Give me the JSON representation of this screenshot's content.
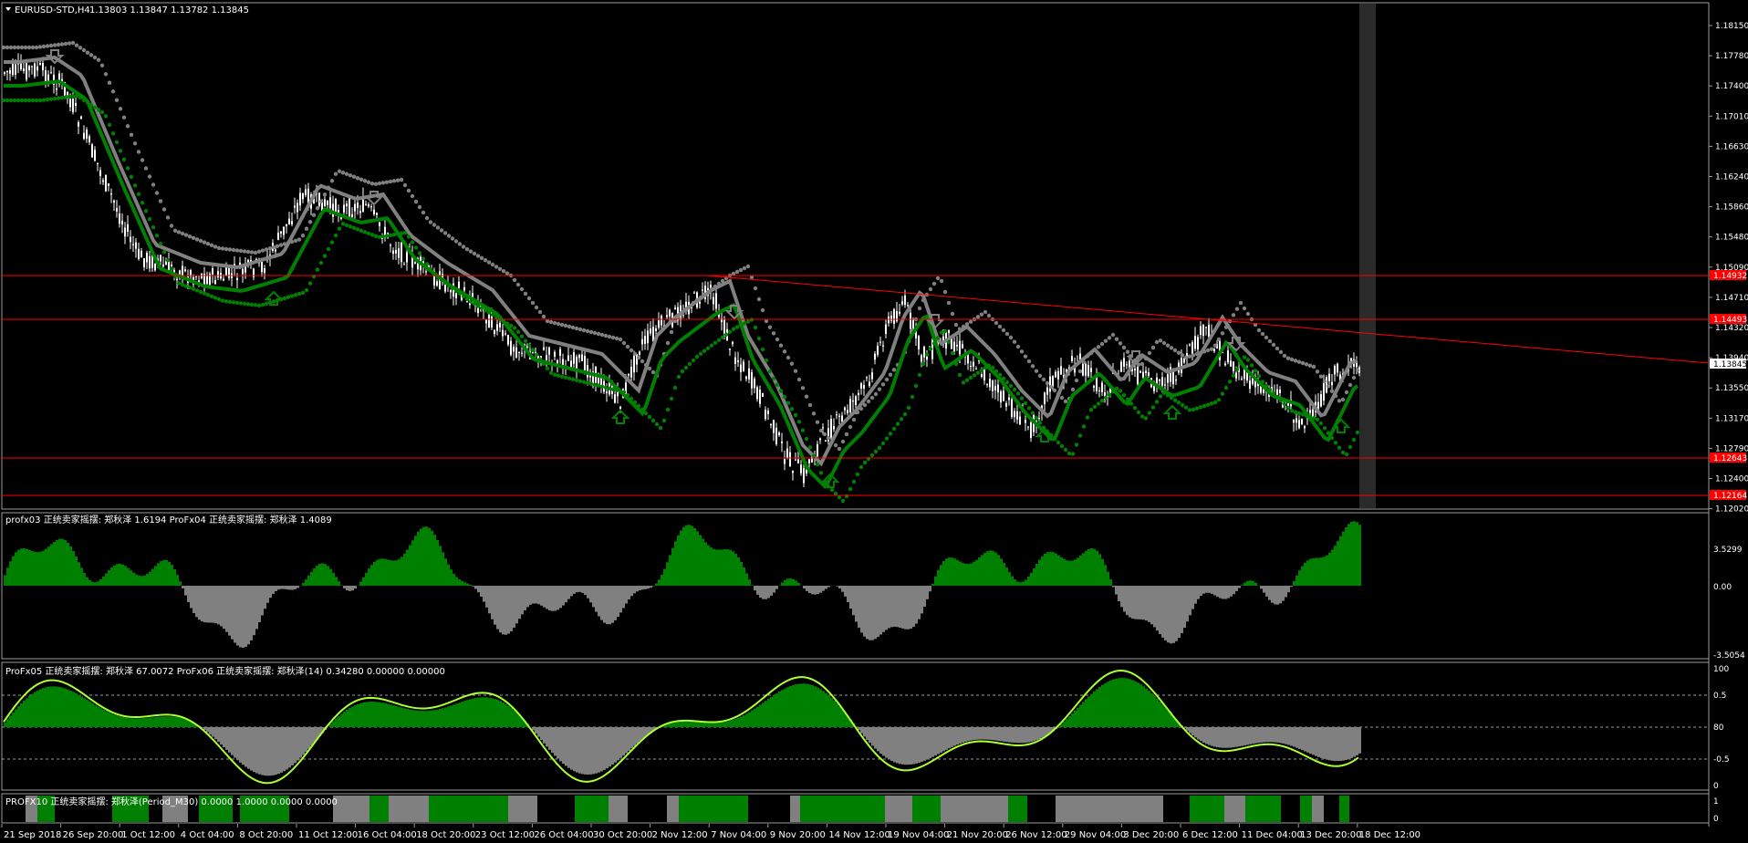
{
  "main_panel": {
    "title": "EURUSD-STD,H4",
    "ohlc": "1.13803 1.13847 1.13782 1.13845",
    "price_ticks": [
      "1.18150",
      "1.17780",
      "1.17400",
      "1.17010",
      "1.16630",
      "1.16240",
      "1.15860",
      "1.15480",
      "1.15090",
      "1.14710",
      "1.14320",
      "1.13940",
      "1.13550",
      "1.13170",
      "1.12790",
      "1.12400",
      "1.12020"
    ],
    "current_price": "1.13845",
    "red_levels": [
      "1.14932",
      "1.14493",
      "1.12643",
      "1.12164"
    ]
  },
  "panel2": {
    "header": "profx03  正统卖家摇摆:  郑秋泽 1.6194  ProFx04  正统卖家摇摆:  郑秋泽 1.4089",
    "ticks": [
      "3.5299",
      "0.00",
      "-3.5054"
    ]
  },
  "panel3": {
    "header": "ProFx05  正统卖家摇摆:  郑秋泽 67.0072  ProFx06  正统卖家摇摆:  郑秋泽(14) 0.34280 0.00000 0.00000",
    "ticks": [
      "100",
      "0.5",
      "80",
      "-0.5",
      "0"
    ]
  },
  "panel4": {
    "header": "PROFX10  正统卖家摇摆:  郑秋泽(Period_M30) 0.0000 1.0000 0.0000 0.0000",
    "ticks": [
      "1",
      "0"
    ]
  },
  "time_axis": [
    "21 Sep 2018",
    "26 Sep 20:00",
    "1 Oct 12:00",
    "4 Oct 04:00",
    "8 Oct 20:00",
    "11 Oct 12:00",
    "16 Oct 04:00",
    "18 Oct 20:00",
    "23 Oct 12:00",
    "26 Oct 04:00",
    "30 Oct 20:00",
    "2 Nov 12:00",
    "7 Nov 04:00",
    "9 Nov 20:00",
    "14 Nov 12:00",
    "19 Nov 04:00",
    "21 Nov 20:00",
    "26 Nov 12:00",
    "29 Nov 04:00",
    "3 Dec 20:00",
    "6 Dec 12:00",
    "11 Dec 04:00",
    "13 Dec 20:00",
    "18 Dec 12:00"
  ],
  "colors": {
    "background": "#000000",
    "candle": "#ffffff",
    "green": "#008000",
    "gray": "#808080",
    "red_line": "#ff0000",
    "oscillator_line": "#adff2f"
  }
}
